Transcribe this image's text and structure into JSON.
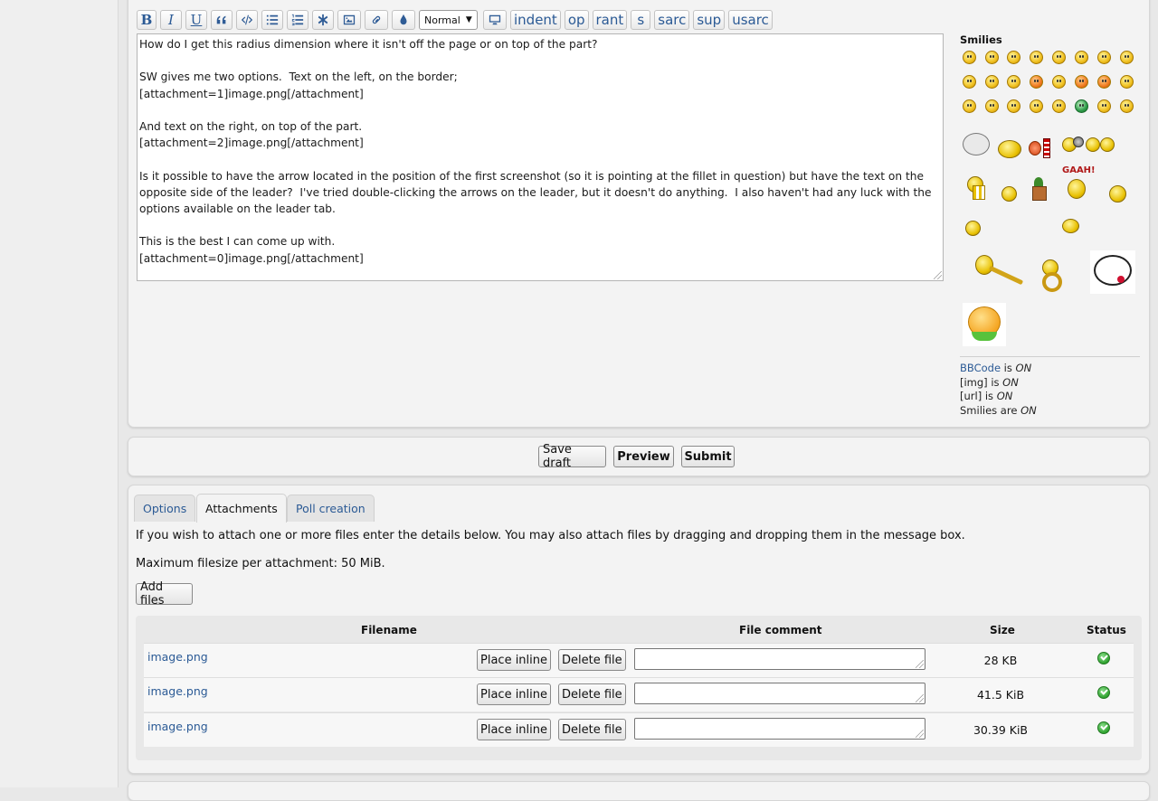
{
  "toolbar": {
    "bold": "B",
    "italic": "I",
    "underline": "U",
    "font_size": "Normal",
    "custom_tags": [
      "indent",
      "op",
      "rant",
      "s",
      "sarc",
      "sup",
      "usarc"
    ]
  },
  "message": {
    "text": "How do I get this radius dimension where it isn't off the page or on top of the part?\n\nSW gives me two options.  Text on the left, on the border;\n[attachment=1]image.png[/attachment]\n\nAnd text on the right, on top of the part.\n[attachment=2]image.png[/attachment]\n\nIs it possible to have the arrow located in the position of the first screenshot (so it is pointing at the fillet in question) but have the text on the opposite side of the leader?  I've tried double-clicking the arrows on the leader, but it doesn't do anything.  I also haven't had any luck with the options available on the leader tab.\n\nThis is the best I can come up with.\n[attachment=0]image.png[/attachment]"
  },
  "smilies": {
    "title": "Smilies",
    "gaah_text": "GAAH!"
  },
  "status": {
    "bbcode_link": "BBCode",
    "bbcode_is": " is ",
    "bbcode_state": "ON",
    "img_label": "[img] is ",
    "img_state": "ON",
    "url_label": "[url] is ",
    "url_state": "ON",
    "smilies_label": "Smilies are ",
    "smilies_state": "ON"
  },
  "actions": {
    "save_draft": "Save draft",
    "preview": "Preview",
    "submit": "Submit"
  },
  "tabs": [
    {
      "label": "Options",
      "active": false
    },
    {
      "label": "Attachments",
      "active": true
    },
    {
      "label": "Poll creation",
      "active": false
    }
  ],
  "attachments": {
    "intro": "If you wish to attach one or more files enter the details below. You may also attach files by dragging and dropping them in the message box.",
    "max_size": "Maximum filesize per attachment: 50 MiB.",
    "add_files": "Add files",
    "columns": {
      "filename": "Filename",
      "comment": "File comment",
      "size": "Size",
      "status": "Status"
    },
    "place_inline_label": "Place inline",
    "delete_label": "Delete file",
    "files": [
      {
        "name": "image.png",
        "size": "28 KB",
        "comment": ""
      },
      {
        "name": "image.png",
        "size": "41.5 KiB",
        "comment": ""
      },
      {
        "name": "image.png",
        "size": "30.39 KiB",
        "comment": ""
      }
    ]
  }
}
